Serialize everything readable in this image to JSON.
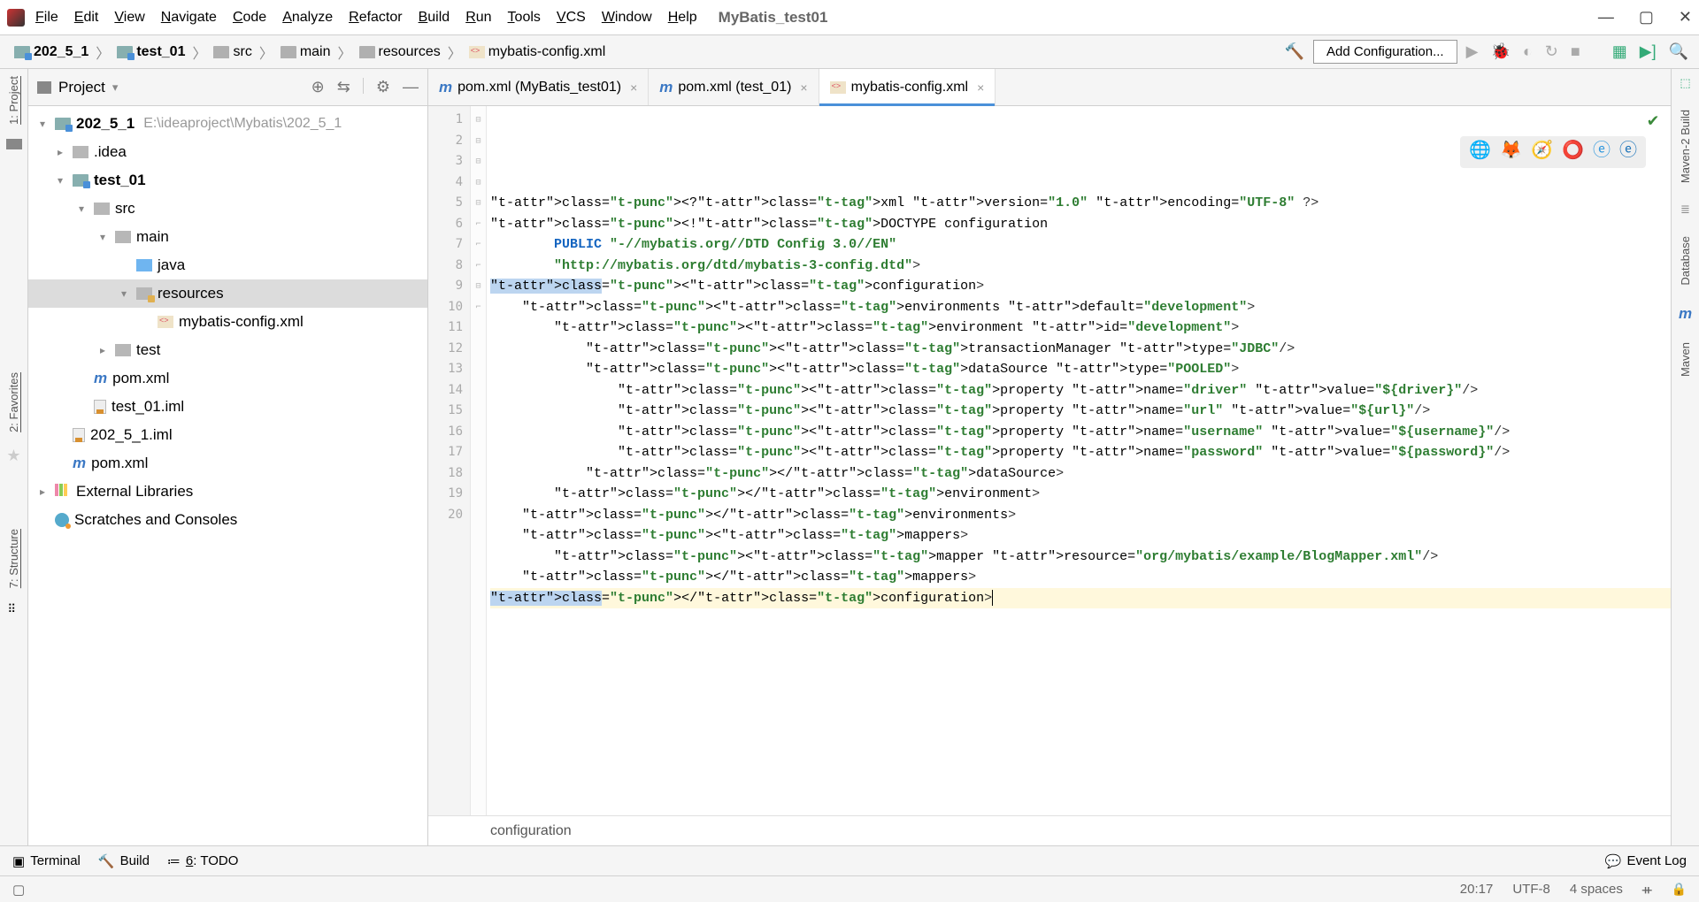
{
  "title": "MyBatis_test01",
  "menu": [
    "File",
    "Edit",
    "View",
    "Navigate",
    "Code",
    "Analyze",
    "Refactor",
    "Build",
    "Run",
    "Tools",
    "VCS",
    "Window",
    "Help"
  ],
  "breadcrumbs": [
    {
      "icon": "folder-blue",
      "label": "202_5_1",
      "bold": true
    },
    {
      "icon": "folder-blue",
      "label": "test_01",
      "bold": true
    },
    {
      "icon": "folder-grey",
      "label": "src"
    },
    {
      "icon": "folder-grey",
      "label": "main"
    },
    {
      "icon": "folder-grey",
      "label": "resources"
    },
    {
      "icon": "xml",
      "label": "mybatis-config.xml"
    }
  ],
  "toolbar": {
    "config_button": "Add Configuration..."
  },
  "sidebar": {
    "title": "Project",
    "root": {
      "name": "202_5_1",
      "path": "E:\\ideaproject\\Mybatis\\202_5_1"
    },
    "nodes": {
      "idea": ".idea",
      "test01": "test_01",
      "src": "src",
      "main": "main",
      "java": "java",
      "resources": "resources",
      "mybatis_xml": "mybatis-config.xml",
      "test": "test",
      "pom1": "pom.xml",
      "iml1": "test_01.iml",
      "iml2": "202_5_1.iml",
      "pom2": "pom.xml",
      "ext_lib": "External Libraries",
      "scratch": "Scratches and Consoles"
    }
  },
  "tabs": [
    {
      "icon": "m",
      "label": "pom.xml (MyBatis_test01)",
      "active": false
    },
    {
      "icon": "m",
      "label": "pom.xml (test_01)",
      "active": false
    },
    {
      "icon": "xml",
      "label": "mybatis-config.xml",
      "active": true
    }
  ],
  "code_breadcrumb": "configuration",
  "left_rail": {
    "project": "1: Project",
    "favorites": "2: Favorites",
    "structure": "7: Structure"
  },
  "right_rail": {
    "maven2": "Maven-2 Build",
    "database": "Database",
    "maven": "Maven"
  },
  "bottom_bar": {
    "terminal": "Terminal",
    "build": "Build",
    "todo": "6: TODO",
    "event_log": "Event Log"
  },
  "status": {
    "pos": "20:17",
    "enc": "UTF-8",
    "indent": "4 spaces"
  },
  "code_lines": [
    "<?xml version=\"1.0\" encoding=\"UTF-8\" ?>",
    "<!DOCTYPE configuration",
    "        PUBLIC \"-//mybatis.org//DTD Config 3.0//EN\"",
    "        \"http://mybatis.org/dtd/mybatis-3-config.dtd\">",
    "<configuration>",
    "    <environments default=\"development\">",
    "        <environment id=\"development\">",
    "            <transactionManager type=\"JDBC\"/>",
    "            <dataSource type=\"POOLED\">",
    "                <property name=\"driver\" value=\"${driver}\"/>",
    "                <property name=\"url\" value=\"${url}\"/>",
    "                <property name=\"username\" value=\"${username}\"/>",
    "                <property name=\"password\" value=\"${password}\"/>",
    "            </dataSource>",
    "        </environment>",
    "    </environments>",
    "    <mappers>",
    "        <mapper resource=\"org/mybatis/example/BlogMapper.xml\"/>",
    "    </mappers>",
    "</configuration>"
  ]
}
